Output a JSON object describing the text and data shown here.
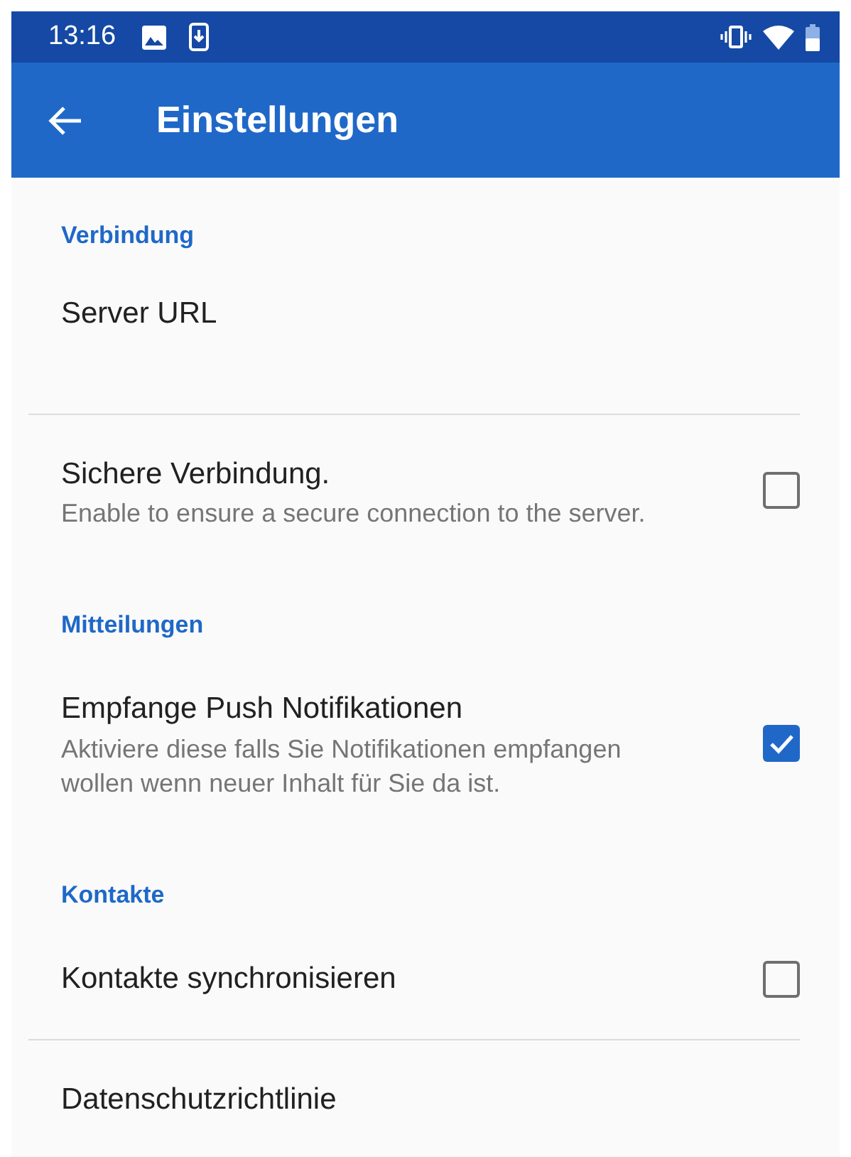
{
  "status_bar": {
    "time": "13:16"
  },
  "app_bar": {
    "title": "Einstellungen"
  },
  "items": [
    {
      "kind": "category",
      "title": "Verbindung"
    },
    {
      "kind": "entry",
      "title": "Server URL",
      "divider": true
    },
    {
      "kind": "checkbox",
      "title": "Sichere Verbindung.",
      "summary": "Enable to ensure a secure connection to the server.",
      "checked": false,
      "divider": false
    },
    {
      "kind": "category",
      "title": "Mitteilungen"
    },
    {
      "kind": "checkbox",
      "title": "Empfange Push Notifikationen",
      "summary": "Aktiviere diese falls Sie Notifikationen empfangen wollen wenn neuer Inhalt für Sie da ist.",
      "checked": true,
      "divider": false
    },
    {
      "kind": "category",
      "title": "Kontakte"
    },
    {
      "kind": "checkbox",
      "title": "Kontakte synchronisieren",
      "checked": false,
      "divider": true
    },
    {
      "kind": "link",
      "title": "Datenschutzrichtlinie",
      "divider": false
    }
  ]
}
